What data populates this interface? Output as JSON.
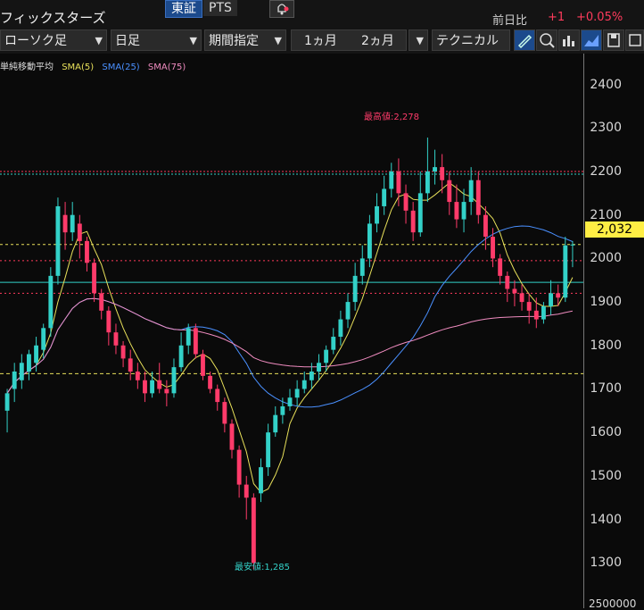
{
  "header": {
    "ticker_name": "フィックスターズ",
    "market_tabs": [
      "東証",
      "PTS"
    ],
    "prev_label": "前日比",
    "prev_change": "+1",
    "prev_pct": "+0.05%"
  },
  "toolbar": {
    "chart_type": "ローソク足",
    "period": "日足",
    "range_mode": "期間指定",
    "range_1m": "1ヵ月",
    "range_2m": "2ヵ月",
    "technical": "テクニカル",
    "icons": [
      "pen-icon",
      "zoom-icon",
      "volume-icon",
      "area-chart-icon",
      "save-icon",
      "settings-icon"
    ]
  },
  "legend": {
    "label": "単純移動平均",
    "sma5": "SMA(5)",
    "sma25": "SMA(25)",
    "sma75": "SMA(75)",
    "colors": {
      "sma5": "#e8e05a",
      "sma25": "#4a90ff",
      "sma75": "#f08cc0"
    }
  },
  "annotations": {
    "high": "最高値:2,278",
    "low": "最安値:1,285"
  },
  "axis": {
    "ticks": [
      "2400",
      "2300",
      "2200",
      "2100",
      "2000",
      "1900",
      "1800",
      "1700",
      "1600",
      "1500",
      "1400",
      "1300"
    ],
    "current_price": "2,032",
    "bottom_tick": "2500000"
  },
  "chart_data": {
    "type": "candlestick",
    "ylim": [
      1280,
      2430
    ],
    "candles": [
      [
        1650,
        1690,
        1600,
        1700
      ],
      [
        1700,
        1740,
        1670,
        1760
      ],
      [
        1720,
        1760,
        1700,
        1780
      ],
      [
        1740,
        1780,
        1720,
        1790
      ],
      [
        1760,
        1800,
        1740,
        1820
      ],
      [
        1790,
        1840,
        1770,
        1850
      ],
      [
        1840,
        1960,
        1820,
        1980
      ],
      [
        1960,
        2120,
        1940,
        2140
      ],
      [
        2100,
        2060,
        2020,
        2130
      ],
      [
        2060,
        2100,
        2040,
        2130
      ],
      [
        2080,
        2040,
        2000,
        2100
      ],
      [
        2040,
        1990,
        1970,
        2050
      ],
      [
        1990,
        1920,
        1900,
        2000
      ],
      [
        1920,
        1880,
        1860,
        1930
      ],
      [
        1880,
        1830,
        1800,
        1890
      ],
      [
        1830,
        1800,
        1780,
        1850
      ],
      [
        1800,
        1770,
        1750,
        1810
      ],
      [
        1770,
        1740,
        1720,
        1790
      ],
      [
        1740,
        1720,
        1700,
        1760
      ],
      [
        1720,
        1690,
        1670,
        1740
      ],
      [
        1690,
        1720,
        1680,
        1740
      ],
      [
        1720,
        1700,
        1690,
        1760
      ],
      [
        1700,
        1690,
        1660,
        1720
      ],
      [
        1690,
        1750,
        1680,
        1770
      ],
      [
        1750,
        1800,
        1740,
        1830
      ],
      [
        1800,
        1840,
        1780,
        1850
      ],
      [
        1840,
        1780,
        1770,
        1850
      ],
      [
        1780,
        1730,
        1720,
        1790
      ],
      [
        1730,
        1700,
        1690,
        1740
      ],
      [
        1700,
        1670,
        1650,
        1710
      ],
      [
        1670,
        1620,
        1600,
        1680
      ],
      [
        1620,
        1560,
        1540,
        1630
      ],
      [
        1560,
        1480,
        1450,
        1570
      ],
      [
        1480,
        1450,
        1400,
        1500
      ],
      [
        1450,
        1300,
        1285,
        1460
      ],
      [
        1460,
        1520,
        1440,
        1540
      ],
      [
        1520,
        1600,
        1500,
        1620
      ],
      [
        1600,
        1640,
        1590,
        1660
      ],
      [
        1640,
        1660,
        1620,
        1680
      ],
      [
        1660,
        1680,
        1650,
        1700
      ],
      [
        1680,
        1700,
        1660,
        1720
      ],
      [
        1700,
        1720,
        1690,
        1740
      ],
      [
        1720,
        1740,
        1700,
        1760
      ],
      [
        1740,
        1760,
        1720,
        1780
      ],
      [
        1760,
        1790,
        1740,
        1800
      ],
      [
        1790,
        1820,
        1780,
        1840
      ],
      [
        1820,
        1860,
        1800,
        1880
      ],
      [
        1860,
        1900,
        1840,
        1920
      ],
      [
        1900,
        1960,
        1880,
        1990
      ],
      [
        1960,
        2000,
        1940,
        2030
      ],
      [
        2000,
        2080,
        1980,
        2100
      ],
      [
        2080,
        2120,
        2060,
        2150
      ],
      [
        2120,
        2160,
        2100,
        2190
      ],
      [
        2160,
        2200,
        2140,
        2220
      ],
      [
        2200,
        2150,
        2120,
        2230
      ],
      [
        2150,
        2110,
        2080,
        2170
      ],
      [
        2110,
        2060,
        2040,
        2130
      ],
      [
        2060,
        2150,
        2050,
        2200
      ],
      [
        2150,
        2200,
        2130,
        2278
      ],
      [
        2200,
        2210,
        2170,
        2250
      ],
      [
        2210,
        2180,
        2150,
        2240
      ],
      [
        2180,
        2130,
        2100,
        2200
      ],
      [
        2130,
        2090,
        2070,
        2170
      ],
      [
        2090,
        2130,
        2060,
        2160
      ],
      [
        2130,
        2180,
        2100,
        2210
      ],
      [
        2180,
        2100,
        2080,
        2200
      ],
      [
        2100,
        2050,
        2020,
        2120
      ],
      [
        2050,
        2000,
        1980,
        2070
      ],
      [
        2000,
        1960,
        1940,
        2010
      ],
      [
        1960,
        1930,
        1900,
        1970
      ],
      [
        1930,
        1920,
        1890,
        1950
      ],
      [
        1920,
        1900,
        1880,
        1940
      ],
      [
        1900,
        1880,
        1850,
        1920
      ],
      [
        1880,
        1860,
        1840,
        1910
      ],
      [
        1860,
        1890,
        1850,
        1900
      ],
      [
        1890,
        1920,
        1870,
        1950
      ],
      [
        1920,
        1910,
        1890,
        1940
      ],
      [
        1910,
        2030,
        1900,
        2050
      ],
      [
        2030,
        2032,
        1980,
        2040
      ]
    ]
  }
}
